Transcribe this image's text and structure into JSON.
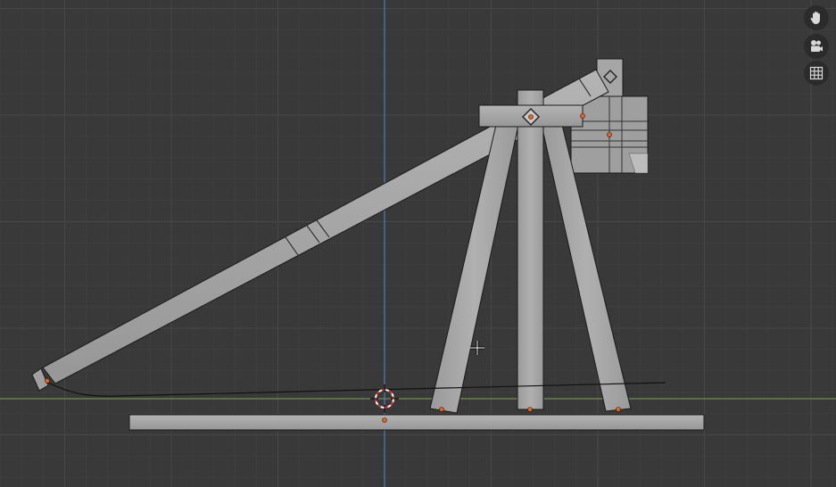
{
  "viewport": {
    "mode": "right-orthographic",
    "grid_visible": true,
    "z_axis_color": "#4b8ad8",
    "y_axis_color": "#7fa63a",
    "background": "#393939",
    "object_color": "#a8a8a8",
    "origin_color": "#e8641e"
  },
  "navigation_gizmo": {
    "buttons": [
      {
        "name": "pan-view-button",
        "icon": "hand-icon"
      },
      {
        "name": "camera-view-button",
        "icon": "camera-icon"
      },
      {
        "name": "toggle-perspective-button",
        "icon": "grid-icon"
      }
    ]
  },
  "scene": {
    "objects": [
      {
        "name": "trebuchet-base-beam"
      },
      {
        "name": "trebuchet-left-leg"
      },
      {
        "name": "trebuchet-center-post"
      },
      {
        "name": "trebuchet-right-leg"
      },
      {
        "name": "trebuchet-axle-crossbar"
      },
      {
        "name": "trebuchet-throwing-arm"
      },
      {
        "name": "trebuchet-counterweight"
      },
      {
        "name": "trebuchet-sling-rope"
      }
    ],
    "cursor_3d": "3d-cursor"
  }
}
